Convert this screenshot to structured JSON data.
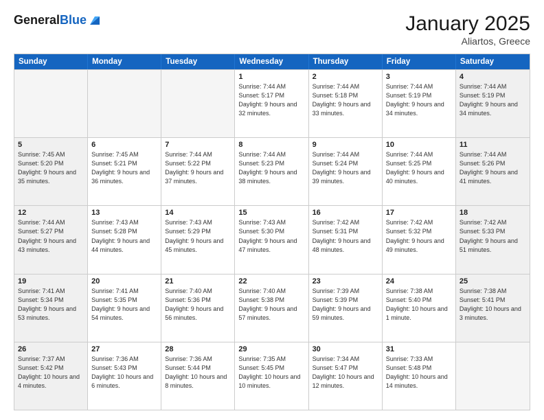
{
  "header": {
    "logo_general": "General",
    "logo_blue": "Blue",
    "month_title": "January 2025",
    "location": "Aliartos, Greece"
  },
  "days_of_week": [
    "Sunday",
    "Monday",
    "Tuesday",
    "Wednesday",
    "Thursday",
    "Friday",
    "Saturday"
  ],
  "rows": [
    [
      {
        "day": "",
        "info": "",
        "empty": true
      },
      {
        "day": "",
        "info": "",
        "empty": true
      },
      {
        "day": "",
        "info": "",
        "empty": true
      },
      {
        "day": "1",
        "info": "Sunrise: 7:44 AM\nSunset: 5:17 PM\nDaylight: 9 hours and 32 minutes.",
        "empty": false
      },
      {
        "day": "2",
        "info": "Sunrise: 7:44 AM\nSunset: 5:18 PM\nDaylight: 9 hours and 33 minutes.",
        "empty": false
      },
      {
        "day": "3",
        "info": "Sunrise: 7:44 AM\nSunset: 5:19 PM\nDaylight: 9 hours and 34 minutes.",
        "empty": false
      },
      {
        "day": "4",
        "info": "Sunrise: 7:44 AM\nSunset: 5:19 PM\nDaylight: 9 hours and 34 minutes.",
        "empty": false,
        "shaded": true
      }
    ],
    [
      {
        "day": "5",
        "info": "Sunrise: 7:45 AM\nSunset: 5:20 PM\nDaylight: 9 hours and 35 minutes.",
        "empty": false,
        "shaded": true
      },
      {
        "day": "6",
        "info": "Sunrise: 7:45 AM\nSunset: 5:21 PM\nDaylight: 9 hours and 36 minutes.",
        "empty": false
      },
      {
        "day": "7",
        "info": "Sunrise: 7:44 AM\nSunset: 5:22 PM\nDaylight: 9 hours and 37 minutes.",
        "empty": false
      },
      {
        "day": "8",
        "info": "Sunrise: 7:44 AM\nSunset: 5:23 PM\nDaylight: 9 hours and 38 minutes.",
        "empty": false
      },
      {
        "day": "9",
        "info": "Sunrise: 7:44 AM\nSunset: 5:24 PM\nDaylight: 9 hours and 39 minutes.",
        "empty": false
      },
      {
        "day": "10",
        "info": "Sunrise: 7:44 AM\nSunset: 5:25 PM\nDaylight: 9 hours and 40 minutes.",
        "empty": false
      },
      {
        "day": "11",
        "info": "Sunrise: 7:44 AM\nSunset: 5:26 PM\nDaylight: 9 hours and 41 minutes.",
        "empty": false,
        "shaded": true
      }
    ],
    [
      {
        "day": "12",
        "info": "Sunrise: 7:44 AM\nSunset: 5:27 PM\nDaylight: 9 hours and 43 minutes.",
        "empty": false,
        "shaded": true
      },
      {
        "day": "13",
        "info": "Sunrise: 7:43 AM\nSunset: 5:28 PM\nDaylight: 9 hours and 44 minutes.",
        "empty": false
      },
      {
        "day": "14",
        "info": "Sunrise: 7:43 AM\nSunset: 5:29 PM\nDaylight: 9 hours and 45 minutes.",
        "empty": false
      },
      {
        "day": "15",
        "info": "Sunrise: 7:43 AM\nSunset: 5:30 PM\nDaylight: 9 hours and 47 minutes.",
        "empty": false
      },
      {
        "day": "16",
        "info": "Sunrise: 7:42 AM\nSunset: 5:31 PM\nDaylight: 9 hours and 48 minutes.",
        "empty": false
      },
      {
        "day": "17",
        "info": "Sunrise: 7:42 AM\nSunset: 5:32 PM\nDaylight: 9 hours and 49 minutes.",
        "empty": false
      },
      {
        "day": "18",
        "info": "Sunrise: 7:42 AM\nSunset: 5:33 PM\nDaylight: 9 hours and 51 minutes.",
        "empty": false,
        "shaded": true
      }
    ],
    [
      {
        "day": "19",
        "info": "Sunrise: 7:41 AM\nSunset: 5:34 PM\nDaylight: 9 hours and 53 minutes.",
        "empty": false,
        "shaded": true
      },
      {
        "day": "20",
        "info": "Sunrise: 7:41 AM\nSunset: 5:35 PM\nDaylight: 9 hours and 54 minutes.",
        "empty": false
      },
      {
        "day": "21",
        "info": "Sunrise: 7:40 AM\nSunset: 5:36 PM\nDaylight: 9 hours and 56 minutes.",
        "empty": false
      },
      {
        "day": "22",
        "info": "Sunrise: 7:40 AM\nSunset: 5:38 PM\nDaylight: 9 hours and 57 minutes.",
        "empty": false
      },
      {
        "day": "23",
        "info": "Sunrise: 7:39 AM\nSunset: 5:39 PM\nDaylight: 9 hours and 59 minutes.",
        "empty": false
      },
      {
        "day": "24",
        "info": "Sunrise: 7:38 AM\nSunset: 5:40 PM\nDaylight: 10 hours and 1 minute.",
        "empty": false
      },
      {
        "day": "25",
        "info": "Sunrise: 7:38 AM\nSunset: 5:41 PM\nDaylight: 10 hours and 3 minutes.",
        "empty": false,
        "shaded": true
      }
    ],
    [
      {
        "day": "26",
        "info": "Sunrise: 7:37 AM\nSunset: 5:42 PM\nDaylight: 10 hours and 4 minutes.",
        "empty": false,
        "shaded": true
      },
      {
        "day": "27",
        "info": "Sunrise: 7:36 AM\nSunset: 5:43 PM\nDaylight: 10 hours and 6 minutes.",
        "empty": false
      },
      {
        "day": "28",
        "info": "Sunrise: 7:36 AM\nSunset: 5:44 PM\nDaylight: 10 hours and 8 minutes.",
        "empty": false
      },
      {
        "day": "29",
        "info": "Sunrise: 7:35 AM\nSunset: 5:45 PM\nDaylight: 10 hours and 10 minutes.",
        "empty": false
      },
      {
        "day": "30",
        "info": "Sunrise: 7:34 AM\nSunset: 5:47 PM\nDaylight: 10 hours and 12 minutes.",
        "empty": false
      },
      {
        "day": "31",
        "info": "Sunrise: 7:33 AM\nSunset: 5:48 PM\nDaylight: 10 hours and 14 minutes.",
        "empty": false
      },
      {
        "day": "",
        "info": "",
        "empty": true,
        "shaded": true
      }
    ]
  ]
}
